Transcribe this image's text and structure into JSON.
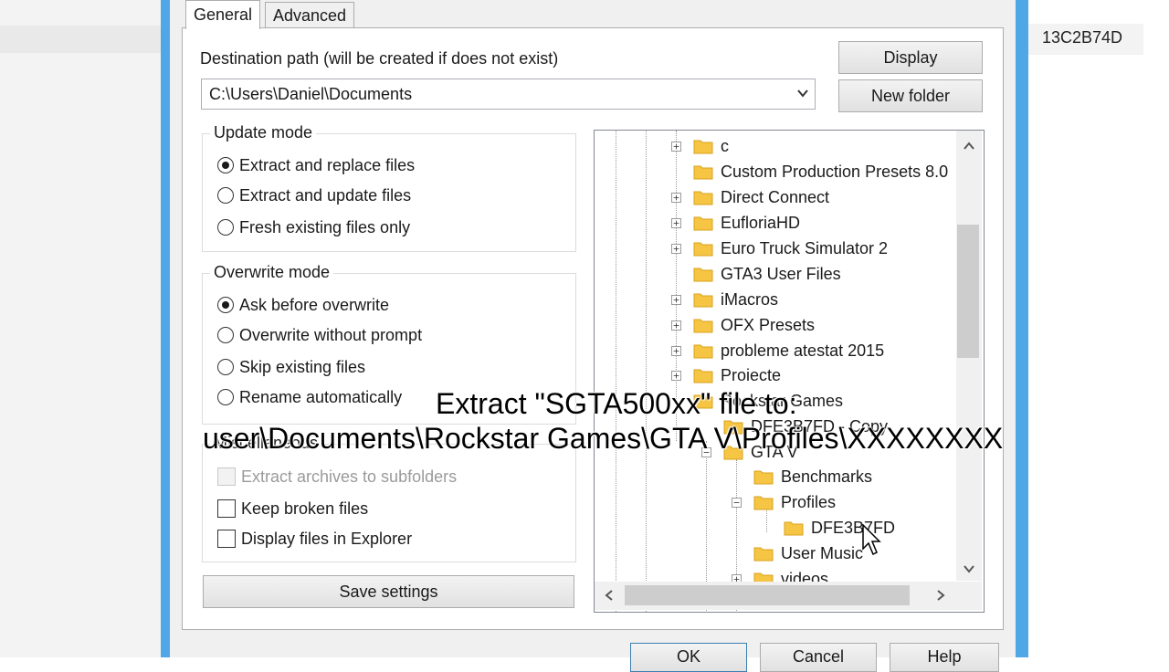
{
  "background": {
    "right_hash": "13C2B74D"
  },
  "tabs": [
    {
      "label": "General",
      "active": true
    },
    {
      "label": "Advanced",
      "active": false
    }
  ],
  "destination": {
    "label": "Destination path (will be created if does not exist)",
    "value": "C:\\Users\\Daniel\\Documents"
  },
  "buttons": {
    "display": "Display",
    "new_folder": "New folder",
    "save_settings": "Save settings",
    "ok": "OK",
    "cancel": "Cancel",
    "help": "Help"
  },
  "update_mode": {
    "title": "Update mode",
    "options": [
      {
        "label": "Extract and replace files",
        "selected": true
      },
      {
        "label": "Extract and update files",
        "selected": false
      },
      {
        "label": "Fresh existing files only",
        "selected": false
      }
    ]
  },
  "overwrite_mode": {
    "title": "Overwrite mode",
    "options": [
      {
        "label": "Ask before overwrite",
        "selected": true
      },
      {
        "label": "Overwrite without prompt",
        "selected": false
      },
      {
        "label": "Skip existing files",
        "selected": false
      },
      {
        "label": "Rename automatically",
        "selected": false
      }
    ]
  },
  "miscellaneous": {
    "title": "Miscellaneous",
    "options": [
      {
        "label": "Extract archives to subfolders",
        "checked": false,
        "disabled": true
      },
      {
        "label": "Keep broken files",
        "checked": false,
        "disabled": false
      },
      {
        "label": "Display files in Explorer",
        "checked": false,
        "disabled": false
      }
    ]
  },
  "tree": {
    "items": [
      "c",
      "Custom Production Presets 8.0",
      "Direct Connect",
      "EufloriaHD",
      "Euro Truck Simulator 2",
      "GTA3 User Files",
      "iMacros",
      "OFX Presets",
      "probleme atestat 2015",
      "Proiecte",
      "Rockstar Games",
      "DFE3B7FD - Copy",
      "GTA V",
      "Benchmarks",
      "Profiles",
      "DFE3B7FD",
      "User Music",
      "videos"
    ]
  },
  "overlay": {
    "line1": "Extract \"SGTA500xx\" file to:",
    "line2": "user\\Documents\\Rockstar Games\\GTA V\\Profiles\\XXXXXXXX"
  },
  "colors": {
    "frame": "#50a7e6",
    "folder": "#f5c543",
    "dialog_bg": "#f0f0f0"
  },
  "icons": {
    "folder": "folder-icon",
    "dropdown": "chevron-down-icon",
    "cursor": "mouse-cursor-icon"
  }
}
